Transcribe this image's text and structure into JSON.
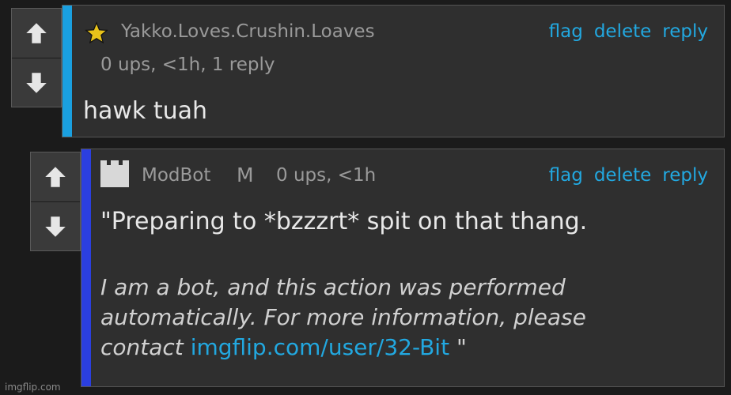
{
  "colors": {
    "accent_link": "#22a8e0",
    "bar_comment1": "#1aa0e0",
    "bar_comment2": "#2b3fe0"
  },
  "comment1": {
    "username": "Yakko.Loves.Crushin.Loaves",
    "meta": "0 ups, <1h, 1 reply",
    "actions": {
      "flag": "flag",
      "delete": "delete",
      "reply": "reply"
    },
    "text": "hawk tuah",
    "badge_icon": "star-icon"
  },
  "comment2": {
    "username": "ModBot",
    "mod_badge": "M",
    "meta": "0 ups, <1h",
    "actions": {
      "flag": "flag",
      "delete": "delete",
      "reply": "reply"
    },
    "text": "\"Preparing to *bzzzrt* spit on that thang.",
    "bot_line1": "I am a bot, and this action was performed",
    "bot_line2": "automatically. For more information, please",
    "bot_line3_prefix": "contact ",
    "bot_link": "imgflip.com/user/32-Bit",
    "bot_suffix": " \"",
    "avatar_icon": "castle-icon"
  },
  "watermark": "imgflip.com"
}
